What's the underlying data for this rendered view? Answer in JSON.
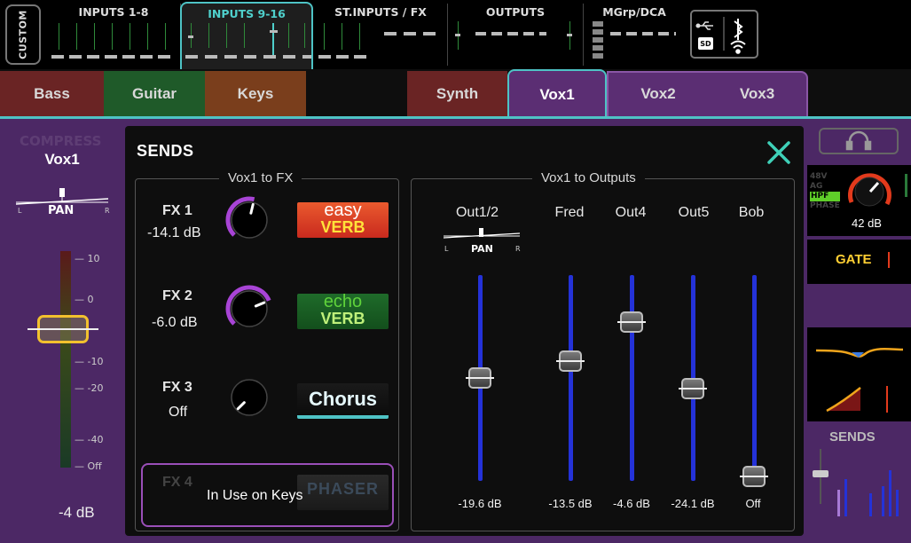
{
  "topbar": {
    "custom_label": "CUSTOM",
    "banks": [
      {
        "label": "INPUTS 1-8",
        "active": false
      },
      {
        "label": "INPUTS 9-16",
        "active": true
      },
      {
        "label": "ST.INPUTS / FX",
        "active": false
      },
      {
        "label": "OUTPUTS",
        "active": false
      },
      {
        "label": "MGrp/DCA",
        "active": false
      }
    ],
    "status_icons": [
      "usb-icon",
      "bluetooth-icon",
      "sd-card-icon",
      "wifi-icon"
    ]
  },
  "tabs": [
    {
      "label": "Bass",
      "color": "#6a2424"
    },
    {
      "label": "Guitar",
      "color": "#1f5a29"
    },
    {
      "label": "Keys",
      "color": "#7a3e1c"
    },
    {
      "label": "",
      "color": "#0e0e0e"
    },
    {
      "label": "Synth",
      "color": "#6a2424"
    },
    {
      "label": "Vox1",
      "color": "#5b2e73",
      "active": true
    },
    {
      "label": "Vox2",
      "color": "#5b2e73"
    },
    {
      "label": "Vox3",
      "color": "#5b2e73"
    }
  ],
  "channel": {
    "name": "Vox1",
    "pan_label": "PAN",
    "pan_l": "L",
    "pan_r": "R",
    "scale": [
      "10",
      "0",
      "10",
      "20",
      "40",
      "Off"
    ],
    "fader_value": "-4 dB",
    "hidden_label": "COMPRESS"
  },
  "sends": {
    "title": "SENDS",
    "fx_group_label": "Vox1 to FX",
    "fx": [
      {
        "name": "FX 1",
        "value": "-14.1 dB",
        "logo_top": "easy",
        "logo_bottom": "VERB",
        "knob_level": 0.55
      },
      {
        "name": "FX 2",
        "value": "-6.0 dB",
        "logo_top": "echo",
        "logo_bottom": "VERB",
        "knob_level": 0.75
      },
      {
        "name": "FX 3",
        "value": "Off",
        "logo_top": "Chorus",
        "logo_bottom": "",
        "knob_level": 0.0
      },
      {
        "name": "FX 4",
        "value": "",
        "logo_top": "PHASER",
        "logo_bottom": "",
        "knob_level": 0.0
      }
    ],
    "in_use_text": "In Use on Keys",
    "out_group_label": "Vox1 to Outputs",
    "pan_label": "PAN",
    "pan_l": "L",
    "pan_r": "R",
    "outputs": [
      {
        "name": "Out1/2",
        "value": "-19.6 dB",
        "level": 0.5
      },
      {
        "name": "Fred",
        "value": "-13.5 dB",
        "level": 0.58
      },
      {
        "name": "Out4",
        "value": "-4.6 dB",
        "level": 0.77
      },
      {
        "name": "Out5",
        "value": "-24.1 dB",
        "level": 0.45
      },
      {
        "name": "Bob",
        "value": "Off",
        "level": 0.02
      }
    ]
  },
  "right": {
    "tags": [
      "48V",
      "AG",
      "HPF",
      "PHASE"
    ],
    "gain": "42 dB",
    "gate": "GATE",
    "sends_label": "SENDS"
  },
  "colors": {
    "accent": "#4ec3c5",
    "purple": "#4c2865",
    "fader_track": "#2432d8",
    "knob_arc": "#a844d6",
    "gate": "#ffcf33"
  }
}
